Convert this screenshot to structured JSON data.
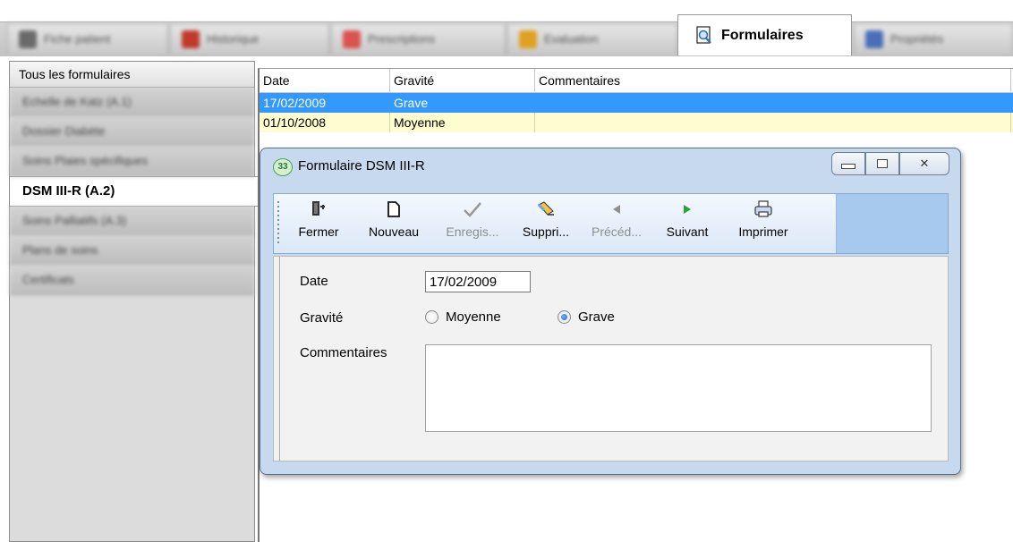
{
  "tabs": [
    {
      "label": "Fiche patient",
      "color": "#6a6a6a"
    },
    {
      "label": "Historique",
      "color": "#c0392b"
    },
    {
      "label": "Prescriptions",
      "color": "#d9534f"
    },
    {
      "label": "Evaluation",
      "color": "#e0a020"
    },
    {
      "label": "Formulaires",
      "color": "#2d6fb7"
    },
    {
      "label": "Propriétés",
      "color": "#4a6fb8"
    }
  ],
  "sidebar": {
    "header": "Tous les formulaires",
    "items": [
      {
        "label": "Echelle de Katz (A.1)"
      },
      {
        "label": "Dossier Diabète"
      },
      {
        "label": "Soins Plaies spécifiques"
      },
      {
        "label": "DSM III-R (A.2)"
      },
      {
        "label": "Soins Palliatifs (A.3)"
      },
      {
        "label": "Plans de soins"
      },
      {
        "label": "Certificats"
      }
    ]
  },
  "grid": {
    "columns": [
      "Date",
      "Gravité",
      "Commentaires"
    ],
    "rows": [
      {
        "date": "17/02/2009",
        "gravite": "Grave",
        "commentaires": ""
      },
      {
        "date": "01/10/2008",
        "gravite": "Moyenne",
        "commentaires": ""
      }
    ]
  },
  "dialog": {
    "icon_text": "33",
    "title": "Formulaire DSM III-R",
    "close_symbol": "✕",
    "toolbar": [
      {
        "label": "Fermer",
        "icon": "exit-icon",
        "glyph": "⇥"
      },
      {
        "label": "Nouveau",
        "icon": "new-document-icon",
        "glyph": "🗋"
      },
      {
        "label": "Enregis...",
        "icon": "checkmark-icon",
        "glyph": "✔"
      },
      {
        "label": "Suppri...",
        "icon": "eraser-icon",
        "glyph": "✎"
      },
      {
        "label": "Précéd...",
        "icon": "previous-icon",
        "glyph": "◀"
      },
      {
        "label": "Suivant",
        "icon": "next-icon",
        "glyph": "▶"
      },
      {
        "label": "Imprimer",
        "icon": "printer-icon",
        "glyph": "⎙"
      }
    ],
    "form": {
      "date_label": "Date",
      "date_value": "17/02/2009",
      "gravite_label": "Gravité",
      "option_moyenne": "Moyenne",
      "option_grave": "Grave",
      "selected": "Grave",
      "commentaires_label": "Commentaires",
      "commentaires_value": ""
    }
  },
  "colors": {
    "selection": "#3399ff",
    "alt_row": "#fffcd0",
    "dialog_frame": "#c7d9ee",
    "next_icon": "#2e9e3a",
    "eraser_icon": "#e6a820",
    "tab_formulaires_icon": "#2d6fb7"
  }
}
